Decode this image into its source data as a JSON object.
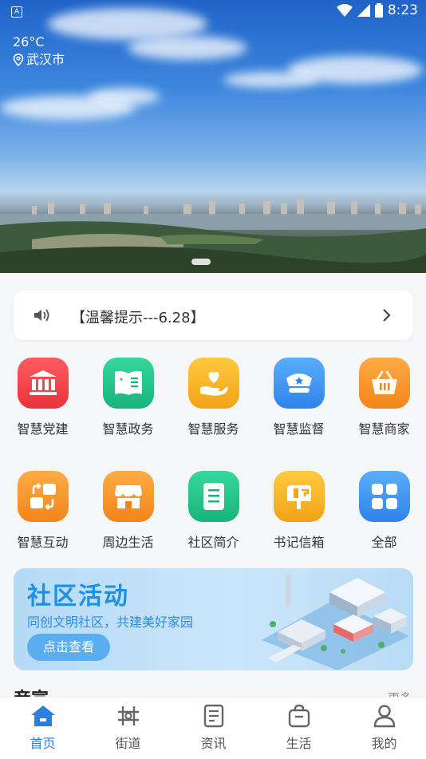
{
  "status_bar": {
    "time": "8:23"
  },
  "weather": {
    "temperature": "26°C",
    "city": "武汉市"
  },
  "notice": {
    "text": "【温馨提示---6.28】"
  },
  "services": [
    {
      "label": "智慧党建",
      "icon": "building-icon",
      "color": "#f0424a"
    },
    {
      "label": "智慧政务",
      "icon": "book-icon",
      "color": "#23c38a"
    },
    {
      "label": "智慧服务",
      "icon": "heart-hand-icon",
      "color": "#f6b12a"
    },
    {
      "label": "智慧监督",
      "icon": "police-cap-icon",
      "color": "#3d95f2"
    },
    {
      "label": "智慧商家",
      "icon": "basket-icon",
      "color": "#f7962c"
    },
    {
      "label": "智慧互动",
      "icon": "interact-icon",
      "color": "#f7962c"
    },
    {
      "label": "周边生活",
      "icon": "shop-icon",
      "color": "#f7962c"
    },
    {
      "label": "社区简介",
      "icon": "document-icon",
      "color": "#23c38a"
    },
    {
      "label": "书记信箱",
      "icon": "mailbox-icon",
      "color": "#f6b12a"
    },
    {
      "label": "全部",
      "icon": "grid-icon",
      "color": "#3d95f2"
    }
  ],
  "activity": {
    "title": "社区活动",
    "subtitle": "同创文明社区，共建美好家园",
    "button": "点击查看"
  },
  "section": {
    "title": "帝宣",
    "more": "更多"
  },
  "tabs": [
    {
      "label": "首页",
      "icon": "home-icon",
      "active": true
    },
    {
      "label": "街道",
      "icon": "street-icon",
      "active": false
    },
    {
      "label": "资讯",
      "icon": "news-icon",
      "active": false
    },
    {
      "label": "生活",
      "icon": "bag-icon",
      "active": false
    },
    {
      "label": "我的",
      "icon": "user-icon",
      "active": false
    }
  ],
  "colors": {
    "accent": "#2a7fe0"
  }
}
